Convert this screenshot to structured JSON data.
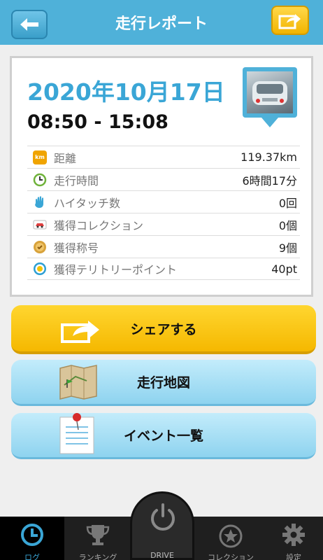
{
  "header": {
    "title": "走行レポート"
  },
  "report": {
    "date": "2020年10月17日",
    "time_range": "08:50 - 15:08",
    "stats": [
      {
        "icon": "km-icon",
        "label": "距離",
        "value": "119.37km",
        "color": "#f0a400"
      },
      {
        "icon": "clock-icon",
        "label": "走行時間",
        "value": "6時間17分",
        "color": "#6fb23a"
      },
      {
        "icon": "hand-icon",
        "label": "ハイタッチ数",
        "value": "0回",
        "color": "#3aa6d6"
      },
      {
        "icon": "car-icon",
        "label": "獲得コレクション",
        "value": "0個",
        "color": "#e04040"
      },
      {
        "icon": "medal-icon",
        "label": "獲得称号",
        "value": "9個",
        "color": "#c98a2a"
      },
      {
        "icon": "spot-icon",
        "label": "獲得テリトリーポイント",
        "value": "40pt",
        "color": "#2c9fd3"
      }
    ],
    "km_badge": "km"
  },
  "actions": {
    "share_label": "シェアする",
    "map_label": "走行地図",
    "event_label": "イベント一覧"
  },
  "tabbar": {
    "log": "ログ",
    "ranking": "ランキング",
    "drive": "DRIVE",
    "collection": "コレクション",
    "settings": "設定"
  },
  "colors": {
    "header": "#4fb1d9",
    "accent": "#3aa6d6",
    "share": "#f5b800"
  }
}
